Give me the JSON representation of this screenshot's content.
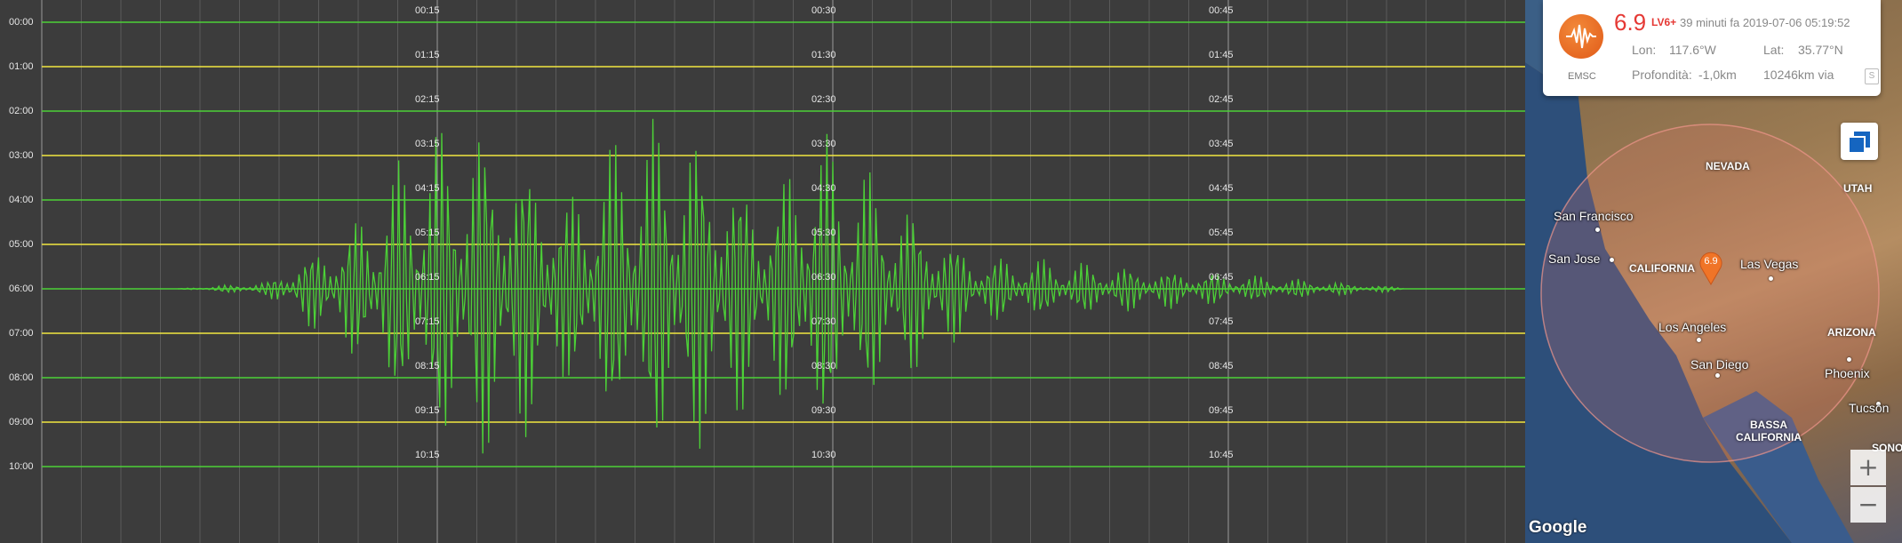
{
  "seismogram": {
    "row_labels": [
      "00:00",
      "01:00",
      "02:00",
      "03:00",
      "04:00",
      "05:00",
      "06:00",
      "07:00",
      "08:00",
      "09:00",
      "10:00"
    ],
    "minute_labels": [
      [
        "00:15",
        "00:30",
        "00:45"
      ],
      [
        "01:15",
        "01:30",
        "01:45"
      ],
      [
        "02:15",
        "02:30",
        "02:45"
      ],
      [
        "03:15",
        "03:30",
        "03:45"
      ],
      [
        "04:15",
        "04:30",
        "04:45"
      ],
      [
        "05:15",
        "05:30",
        "05:45"
      ],
      [
        "06:15",
        "06:30",
        "06:45"
      ],
      [
        "07:15",
        "07:30",
        "07:45"
      ],
      [
        "08:15",
        "08:30",
        "08:45"
      ],
      [
        "09:15",
        "09:30",
        "09:45"
      ],
      [
        "10:15",
        "10:30",
        "10:45"
      ]
    ],
    "colors": {
      "trace_green": "#4cd137",
      "trace_yellow": "#f1e740",
      "background": "#3c3c3c",
      "grid": "#5a5a5a"
    }
  },
  "event_card": {
    "agency": "EMSC",
    "magnitude": "6.9",
    "level": "LV6+",
    "ago": "39 minuti fa 2019-07-06 05:19:52",
    "lon_label": "Lon:",
    "lon_value": "117.6°W",
    "lat_label": "Lat:",
    "lat_value": "35.77°N",
    "depth_label": "Profondità:",
    "depth_value": "-1,0km",
    "distance": "10246km via",
    "share_icon": "S",
    "accent": "#e53935"
  },
  "map": {
    "marker_label": "6.9",
    "cities": [
      "San Francisco",
      "San Jose",
      "Las Vegas",
      "Los Angeles",
      "San Diego",
      "Phoenix",
      "Tucson"
    ],
    "regions": [
      "NEVADA",
      "UTAH",
      "CALIFORNIA",
      "ARIZONA",
      "BASSA CALIFORNIA",
      "SONOR"
    ],
    "attribution": "Google",
    "zoom_in": "+",
    "zoom_out": "−"
  }
}
